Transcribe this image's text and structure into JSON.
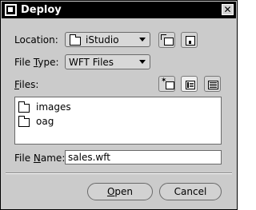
{
  "window": {
    "title": "Deploy",
    "close_glyph": "✕"
  },
  "location": {
    "label": "Location:",
    "value": "iStudio",
    "folder_icon": "folder-icon"
  },
  "toolbar": {
    "up_icon": "up-folder-icon",
    "home_icon": "home-folder-icon",
    "new_icon": "new-folder-icon",
    "list_icon": "list-view-icon",
    "details_icon": "details-view-icon"
  },
  "file_type": {
    "label_prefix": "File ",
    "label_mnemonic": "T",
    "label_suffix": "ype:",
    "value": "WFT Files"
  },
  "files": {
    "label_mnemonic": "F",
    "label_suffix": "iles:",
    "items": [
      {
        "name": "images"
      },
      {
        "name": "oag"
      }
    ]
  },
  "file_name": {
    "label_prefix": "File ",
    "label_mnemonic": "N",
    "label_suffix": "ame:",
    "value": "sales.wft"
  },
  "buttons": {
    "open_mnemonic": "O",
    "open_suffix": "pen",
    "cancel_label": "Cancel"
  },
  "colors": {
    "window_bg": "#cbcbcb",
    "titlebar_bg": "#000000",
    "titlebar_text": "#ffffff"
  }
}
